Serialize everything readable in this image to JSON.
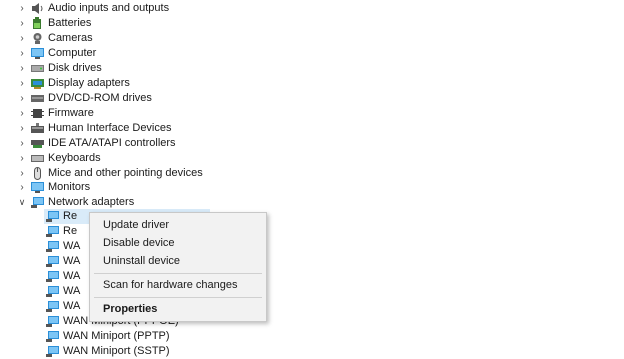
{
  "tree": {
    "categories": [
      {
        "label": "Audio inputs and outputs",
        "icon": "speaker-icon"
      },
      {
        "label": "Batteries",
        "icon": "battery-icon"
      },
      {
        "label": "Cameras",
        "icon": "camera-icon"
      },
      {
        "label": "Computer",
        "icon": "monitor-icon"
      },
      {
        "label": "Disk drives",
        "icon": "disk-icon"
      },
      {
        "label": "Display adapters",
        "icon": "display-adapter-icon"
      },
      {
        "label": "DVD/CD-ROM drives",
        "icon": "dvd-icon"
      },
      {
        "label": "Firmware",
        "icon": "chip-icon"
      },
      {
        "label": "Human Interface Devices",
        "icon": "hid-icon"
      },
      {
        "label": "IDE ATA/ATAPI controllers",
        "icon": "ide-icon"
      },
      {
        "label": "Keyboards",
        "icon": "keyboard-icon"
      },
      {
        "label": "Mice and other pointing devices",
        "icon": "mouse-icon"
      },
      {
        "label": "Monitors",
        "icon": "monitor-icon"
      },
      {
        "label": "Network adapters",
        "icon": "network-icon"
      }
    ],
    "network_children": [
      {
        "label": "Re"
      },
      {
        "label": "Re"
      },
      {
        "label": "WA"
      },
      {
        "label": "WA"
      },
      {
        "label": "WA"
      },
      {
        "label": "WA"
      },
      {
        "label": "WA"
      },
      {
        "label": "WAN Miniport (PPPOE)"
      },
      {
        "label": "WAN Miniport (PPTP)"
      },
      {
        "label": "WAN Miniport (SSTP)"
      }
    ]
  },
  "context_menu": {
    "update": "Update driver",
    "disable": "Disable device",
    "uninstall": "Uninstall device",
    "scan": "Scan for hardware changes",
    "properties": "Properties"
  }
}
